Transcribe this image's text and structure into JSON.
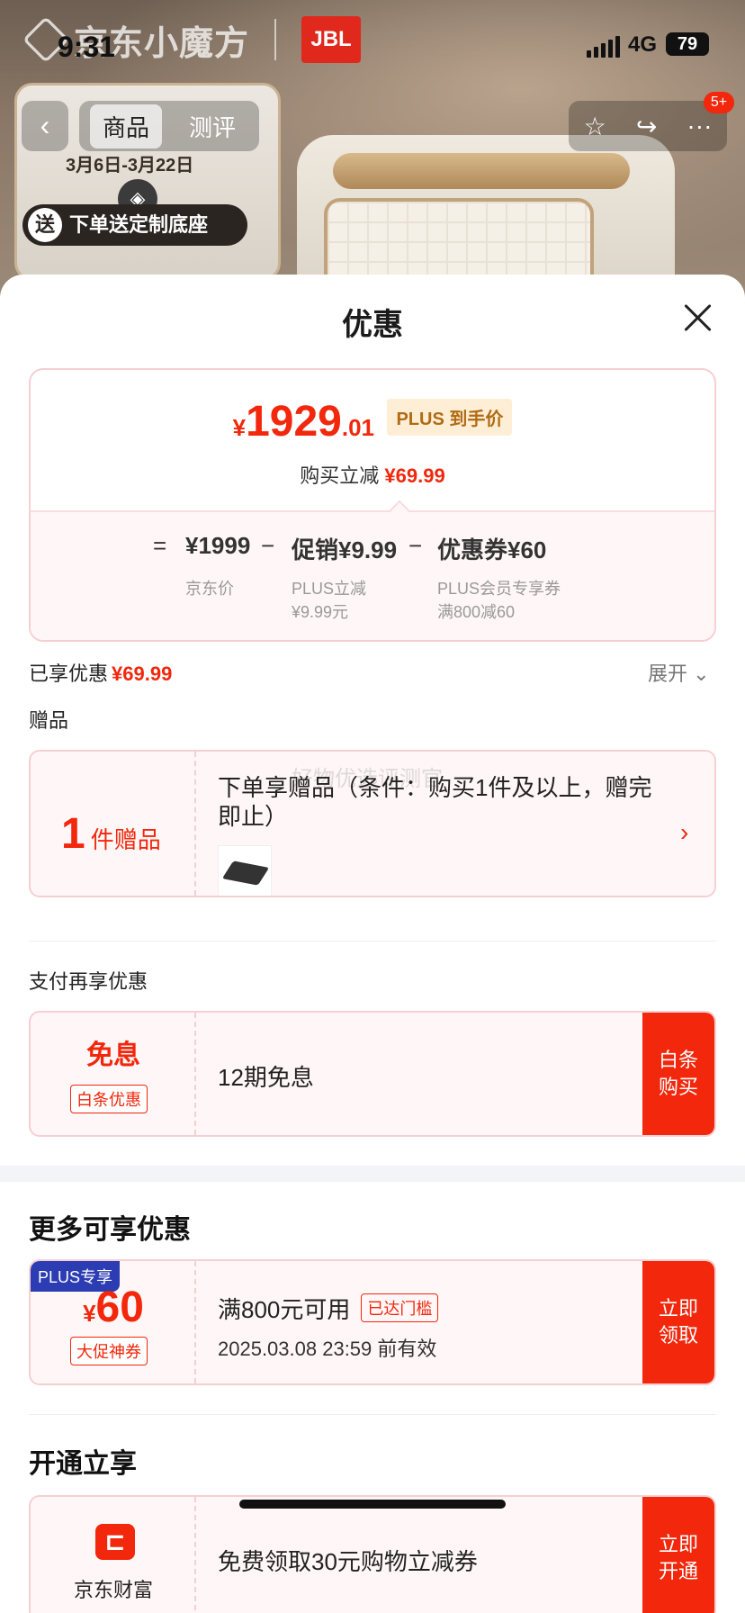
{
  "banner": {
    "brand": "京东小魔方",
    "partner": "JBL",
    "promo_dates": "3月6日-3月22日",
    "promo_gift": "下单送定制底座",
    "promo_gift_badge": "送"
  },
  "status": {
    "time": "9:31",
    "network": "4G",
    "battery": "79"
  },
  "nav": {
    "back_icon": "‹",
    "tabs": [
      {
        "label": "商品"
      },
      {
        "label": "测评"
      }
    ],
    "badge": "5+"
  },
  "sheet": {
    "title": "优惠",
    "price": {
      "yen": "¥",
      "int": "1929",
      "dec": ".01",
      "plus_tag": "PLUS 到手价"
    },
    "reduce": {
      "label": "购买立减",
      "value": "¥69.99"
    },
    "formula": {
      "eq": "=",
      "jd_price": "¥1999",
      "minus1": "−",
      "promo": "促销¥9.99",
      "minus2": "−",
      "coupon": "优惠券¥60",
      "jd_price_label": "京东价",
      "promo_sub1": "PLUS立减",
      "promo_sub2": "¥9.99元",
      "coupon_sub1": "PLUS会员专享券",
      "coupon_sub2": "满800减60"
    },
    "enjoyed": {
      "label": "已享优惠",
      "value": "¥69.99",
      "expand": "展开"
    },
    "gift_section": {
      "label": "赠品",
      "count": "1",
      "unit": "件赠品",
      "desc": "下单享赠品（条件：购买1件及以上，赠完即止）",
      "watermark": "好物优选评测官"
    },
    "pay_section": {
      "label": "支付再享优惠",
      "title": "免息",
      "tag": "白条优惠",
      "text": "12期免息",
      "button": "白条购买"
    },
    "more_section": {
      "title": "更多可享优惠",
      "plus_tag": "PLUS专享",
      "yen": "¥",
      "amount": "60",
      "tag": "大促神券",
      "condition": "满800元可用",
      "reached": "已达门槛",
      "expiry": "2025.03.08 23:59 前有效",
      "button": "立即领取"
    },
    "open_section": {
      "title": "开通立享",
      "brand": "京东财富",
      "text": "免费领取30元购物立减券",
      "button": "立即开通"
    }
  }
}
